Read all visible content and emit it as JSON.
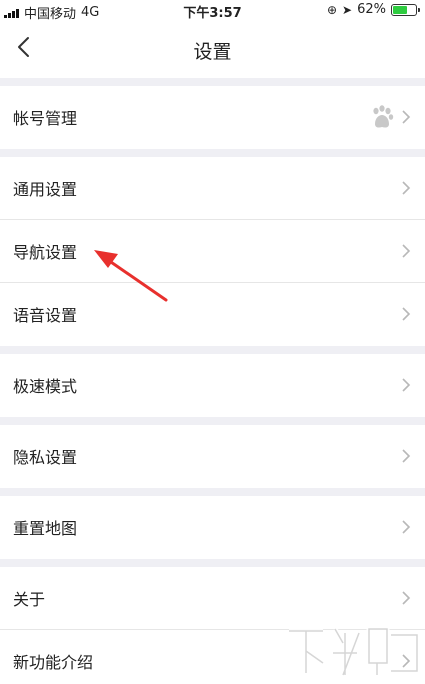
{
  "status_bar": {
    "carrier": "中国移动",
    "network": "4G",
    "time": "下午3:57",
    "battery": "62%",
    "battery_level": 0.62,
    "lock_glyph": "⊕",
    "location_glyph": "➤"
  },
  "header": {
    "back_label": "<",
    "title": "设置"
  },
  "groups": [
    {
      "items": [
        {
          "label": "帐号管理",
          "has_badge": true
        }
      ]
    },
    {
      "items": [
        {
          "label": "通用设置"
        },
        {
          "label": "导航设置"
        },
        {
          "label": "语音设置"
        }
      ]
    },
    {
      "items": [
        {
          "label": "极速模式"
        }
      ]
    },
    {
      "items": [
        {
          "label": "隐私设置"
        }
      ]
    },
    {
      "items": [
        {
          "label": "重置地图"
        }
      ]
    },
    {
      "items": [
        {
          "label": "关于"
        },
        {
          "label": "新功能介绍"
        }
      ]
    }
  ],
  "annotation": {
    "color": "#e8302d"
  },
  "colors": {
    "background": "#efeff4",
    "divider": "#e6e6e6",
    "chevron": "#b8b8b8",
    "battery": "#2ecc40"
  }
}
